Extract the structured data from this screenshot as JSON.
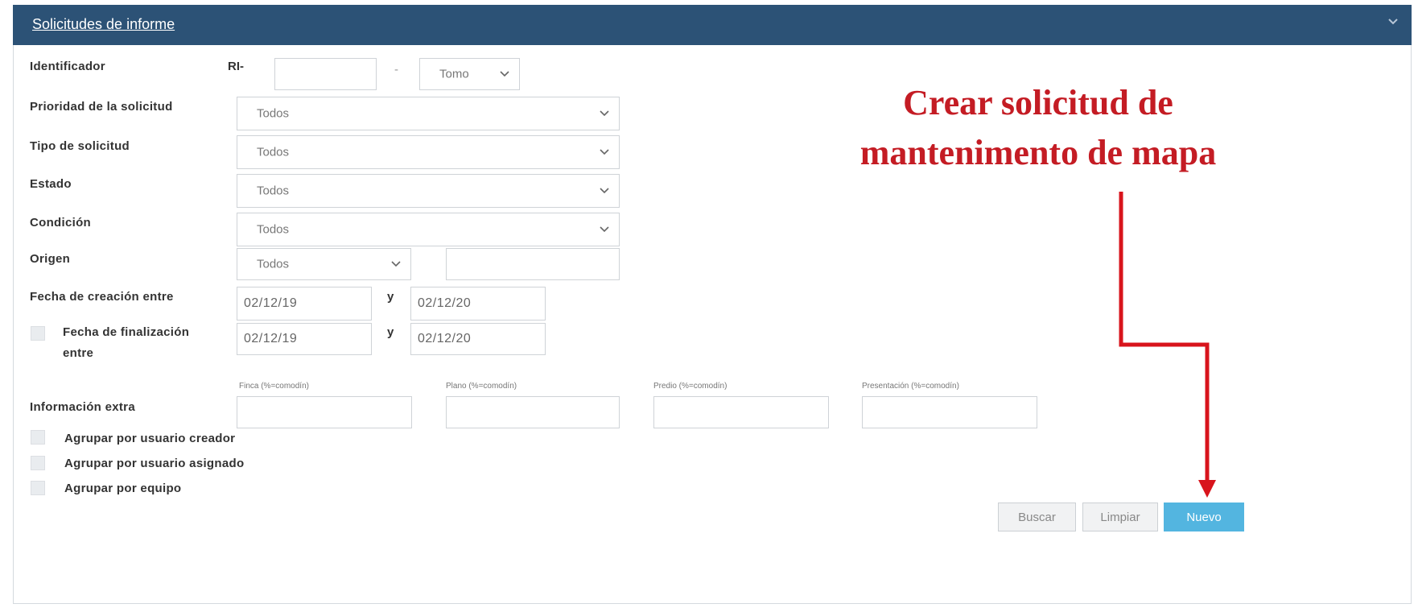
{
  "panel": {
    "title": "Solicitudes de informe"
  },
  "fields": {
    "identificador": {
      "label": "Identificador",
      "prefix": "RI-",
      "value": "",
      "dash": "-",
      "tomo": "Tomo"
    },
    "prioridad": {
      "label": "Prioridad de la solicitud",
      "value": "Todos"
    },
    "tipo": {
      "label": "Tipo de solicitud",
      "value": "Todos"
    },
    "estado": {
      "label": "Estado",
      "value": "Todos"
    },
    "condicion": {
      "label": "Condición",
      "value": "Todos"
    },
    "origen": {
      "label": "Origen",
      "value": "Todos",
      "text": ""
    },
    "fecha_creacion": {
      "label": "Fecha de creación entre",
      "from": "02/12/19",
      "and": "y",
      "to": "02/12/20"
    },
    "fecha_finalizacion": {
      "label_line1": "Fecha de finalización",
      "label_line2": "entre",
      "from": "02/12/19",
      "and": "y",
      "to": "02/12/20",
      "checked": false
    },
    "informacion_extra": {
      "label": "Información extra",
      "finca": "Finca (%=comodín)",
      "plano": "Plano (%=comodín)",
      "predio": "Predio (%=comodín)",
      "presentacion": "Presentación (%=comodín)"
    }
  },
  "checkboxes": {
    "creador": "Agrupar por usuario creador",
    "asignado": "Agrupar por usuario asignado",
    "equipo": "Agrupar por equipo"
  },
  "buttons": {
    "buscar": "Buscar",
    "limpiar": "Limpiar",
    "nuevo": "Nuevo"
  },
  "annotation": {
    "line1": "Crear solicitud de",
    "line2": "mantenimento de mapa",
    "color": "#c41c24"
  },
  "colors": {
    "header": "#2c5276",
    "primary": "#53b5e0"
  }
}
